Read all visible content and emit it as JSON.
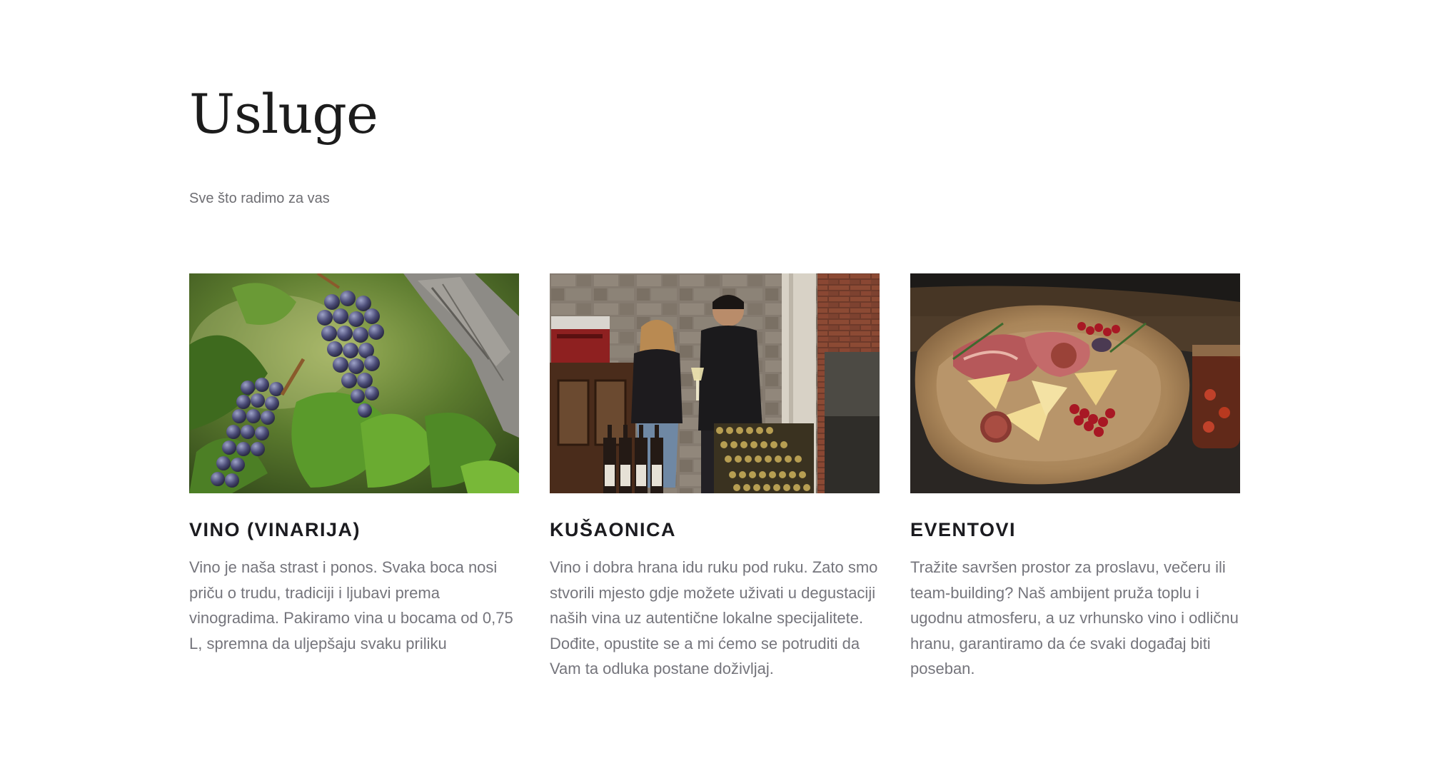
{
  "section": {
    "title": "Usluge",
    "subtitle": "Sve što radimo za vas"
  },
  "cards": [
    {
      "title": "VINO (VINARIJA)",
      "text": "Vino je naša strast i ponos. Svaka boca nosi priču o trudu, tradiciji i ljubavi prema vinogradima. Pakiramo vina u bocama od 0,75 L, spremna da uljepšaju svaku priliku",
      "image": "grapes-vineyard-photo"
    },
    {
      "title": "KUŠAONICA",
      "text": "Vino i dobra hrana idu ruku pod ruku. Zato smo stvorili mjesto gdje možete uživati u degustaciji naših vina uz autentične lokalne specijalitete. Dođite, opustite se a mi ćemo se potruditi da Vam ta odluka postane doživljaj.",
      "image": "tasting-room-photo"
    },
    {
      "title": "EVENTOVI",
      "text": "Tražite savršen prostor za proslavu, večeru ili team-building? Naš ambijent pruža toplu i ugodnu atmosferu, a uz vrhunsko vino i odličnu hranu, garantiramo da će svaki događaj biti poseban.",
      "image": "charcuterie-board-photo"
    }
  ]
}
